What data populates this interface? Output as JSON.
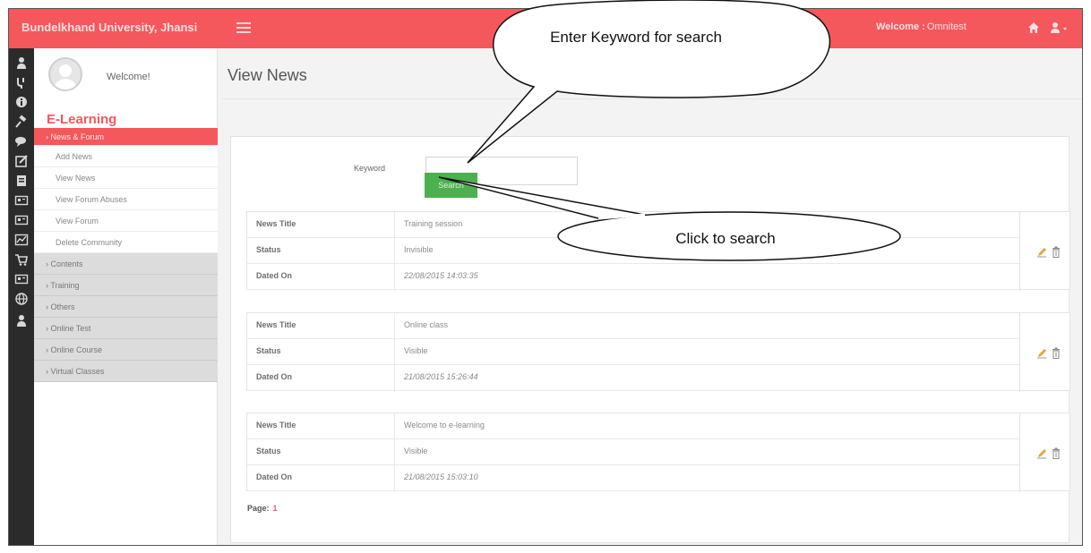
{
  "header": {
    "brand": "Bundelkhand University, Jhansi",
    "welcome_label": "Welcome :",
    "username": "Omnitest",
    "colors": {
      "accent": "#f4585c",
      "rail": "#2b2b2b",
      "button": "#4cb04e"
    }
  },
  "rail_icons": [
    "user-icon",
    "graduation-icon",
    "info-icon",
    "gavel-icon",
    "comments-icon",
    "edit-icon",
    "book-icon",
    "id-card-icon",
    "id-card-icon",
    "chart-icon",
    "cart-icon",
    "id-card-icon",
    "globe-icon",
    "user-icon"
  ],
  "sidebar": {
    "welcome": "Welcome!",
    "module": "E-Learning",
    "active_section": "News & Forum",
    "sub_items": [
      "Add News",
      "View News",
      "View Forum Abuses",
      "View Forum",
      "Delete Community"
    ],
    "categories": [
      "Contents",
      "Training",
      "Others",
      "Online Test",
      "Online Course",
      "Virtual Classes"
    ]
  },
  "main": {
    "title": "View News",
    "search": {
      "label": "Keyword",
      "value": "",
      "placeholder": "",
      "button": "Search"
    },
    "news": [
      {
        "title_label": "News Title",
        "title": "Training session",
        "status_label": "Status",
        "status": "Invisible",
        "date_label": "Dated On",
        "date": "22/08/2015 14:03:35"
      },
      {
        "title_label": "News Title",
        "title": "Online class",
        "status_label": "Status",
        "status": "Visible",
        "date_label": "Dated On",
        "date": "21/08/2015 15:26:44"
      },
      {
        "title_label": "News Title",
        "title": "Welcome to e-learning",
        "status_label": "Status",
        "status": "Visible",
        "date_label": "Dated On",
        "date": "21/08/2015 15:03:10"
      }
    ],
    "pager": {
      "label": "Page:",
      "current": "1"
    }
  },
  "callouts": {
    "keyword": "Enter Keyword for search",
    "search": "Click to search"
  }
}
